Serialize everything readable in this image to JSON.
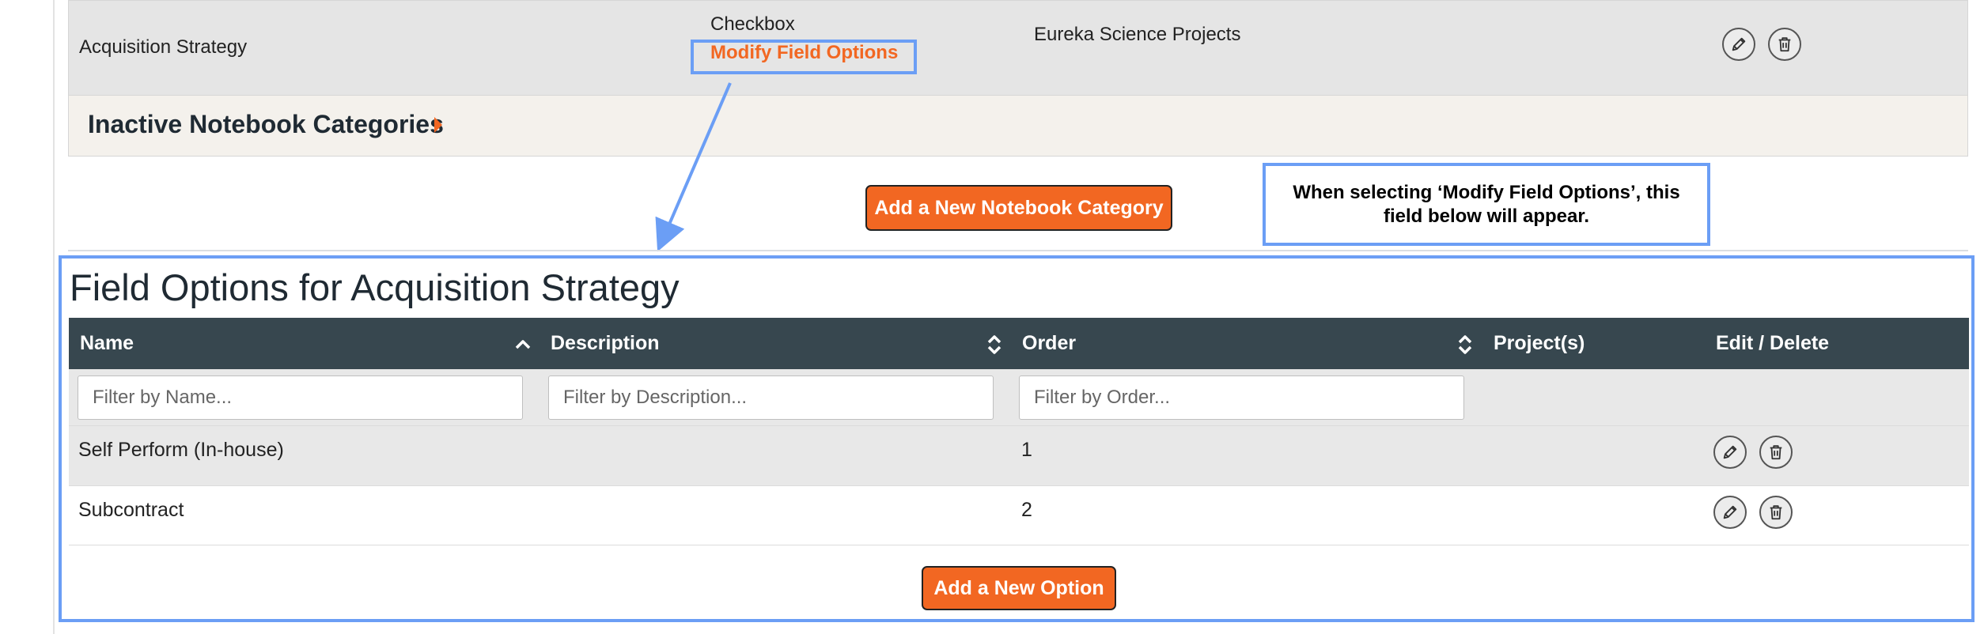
{
  "category_row": {
    "name": "Acquisition Strategy",
    "field_type": "Checkbox",
    "modify_link": "Modify Field Options",
    "project": "Eureka Science Projects"
  },
  "inactive_section": {
    "title": "Inactive Notebook Categories"
  },
  "add_category_button": "Add a New Notebook Category",
  "callout": {
    "text": "When selecting ‘Modify Field Options’, this field below will appear."
  },
  "field_options": {
    "title": "Field Options for Acquisition Strategy",
    "columns": [
      "Name",
      "Description",
      "Order",
      "Project(s)",
      "Edit / Delete"
    ],
    "filters": {
      "name_placeholder": "Filter by Name...",
      "description_placeholder": "Filter by Description...",
      "order_placeholder": "Filter by Order..."
    },
    "rows": [
      {
        "name": "Self Perform (In-house)",
        "description": "",
        "order": "1",
        "projects": ""
      },
      {
        "name": "Subcontract",
        "description": "",
        "order": "2",
        "projects": ""
      }
    ],
    "add_option_button": "Add a New Option"
  },
  "colors": {
    "accent_orange": "#f26722",
    "header_dark": "#37474f",
    "highlight_blue": "#6b9ef5",
    "row_gray": "#e8e8e8"
  },
  "icons": [
    "pencil-icon",
    "trash-icon",
    "sort-asc-icon",
    "sort-both-icon",
    "caret-right-icon",
    "arrow-icon"
  ]
}
